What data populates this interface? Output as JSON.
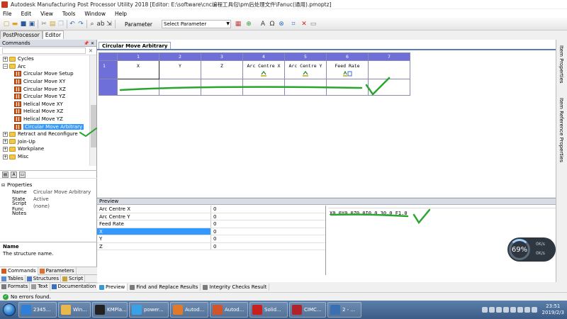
{
  "window": {
    "title": "Autodesk Manufacturing Post Processor Utility 2018 [Editor: E:\\software\\cnc编程工具包\\pm后处理文件\\Fanuc(通用).pmoptz]"
  },
  "menu": [
    "File",
    "Edit",
    "View",
    "Tools",
    "Window",
    "Help"
  ],
  "toolbar": {
    "parameter_label": "Parameter",
    "select_parameter": "Select Parameter"
  },
  "top_tabs": [
    "PostProcessor",
    "Editor"
  ],
  "commands_panel": {
    "header": "Commands",
    "pin": "📌",
    "close": "✕",
    "tree": [
      {
        "label": "Cycles",
        "kind": "folder",
        "expander": "+",
        "indent": 1
      },
      {
        "label": "Arc",
        "kind": "folder",
        "expander": "−",
        "indent": 1
      },
      {
        "label": "Circular Move Setup",
        "kind": "item",
        "indent": 2
      },
      {
        "label": "Circular Move XY",
        "kind": "item",
        "indent": 2
      },
      {
        "label": "Circular Move XZ",
        "kind": "item",
        "indent": 2
      },
      {
        "label": "Circular Move YZ",
        "kind": "item",
        "indent": 2
      },
      {
        "label": "Helical Move XY",
        "kind": "item",
        "indent": 2
      },
      {
        "label": "Helical Move XZ",
        "kind": "item",
        "indent": 2
      },
      {
        "label": "Helical Move YZ",
        "kind": "item",
        "indent": 2
      },
      {
        "label": "Circular Move Arbitrary",
        "kind": "item",
        "indent": 2,
        "selected": true
      },
      {
        "label": "Retract and Reconfigure",
        "kind": "folder",
        "expander": "+",
        "indent": 1
      },
      {
        "label": "Join-Up",
        "kind": "folder",
        "expander": "+",
        "indent": 1
      },
      {
        "label": "Workplane",
        "kind": "folder",
        "expander": "+",
        "indent": 1
      },
      {
        "label": "Misc",
        "kind": "folder",
        "expander": "+",
        "indent": 1
      }
    ]
  },
  "properties": {
    "group": "Properties",
    "rows": [
      {
        "key": "Name",
        "value": "Circular Move Arbitrary"
      },
      {
        "key": "State",
        "value": "Active"
      },
      {
        "key": "Script Func",
        "value": "(none)"
      },
      {
        "key": "Notes",
        "value": ""
      }
    ],
    "desc_title": "Name",
    "desc_text": "The structure name."
  },
  "left_bottom_tabs": {
    "row1": [
      "Commands",
      "Parameters"
    ],
    "row2": [
      "Tables",
      "Structures",
      "Script"
    ],
    "row3": [
      "Formats",
      "Text",
      "Documentation"
    ]
  },
  "editor": {
    "doc_tab": "Circular Move Arbitrary",
    "column_numbers": [
      "1",
      "2",
      "3",
      "4",
      "5",
      "6",
      "7"
    ],
    "row_number": "1",
    "cells": [
      "X",
      "Y",
      "Z",
      "Arc Centre X",
      "Arc Centre Y",
      "Feed Rate",
      ""
    ]
  },
  "right_vertical_tabs": [
    "Item Properties",
    "Item Reference Properties"
  ],
  "preview": {
    "header": "Preview",
    "rows": [
      {
        "name": "Arc Centre X",
        "value": "0"
      },
      {
        "name": "Arc Centre Y",
        "value": "0"
      },
      {
        "name": "Feed Rate",
        "value": "0"
      },
      {
        "name": "X",
        "value": "0",
        "selected": true
      },
      {
        "name": "Y",
        "value": "0"
      },
      {
        "name": "Z",
        "value": "0"
      }
    ],
    "output": "X0.0Y0.0Z0.0I0.0 30.0 F1.0",
    "tabs": [
      "Preview",
      "Find and Replace Results",
      "Integrity Checks Result"
    ]
  },
  "status": {
    "text": "No errors found."
  },
  "gauge": {
    "value": "69%",
    "up": "0K/s",
    "down": "0K/s"
  },
  "taskbar": {
    "buttons": [
      {
        "label": "2345...",
        "color": "#2f7fd8"
      },
      {
        "label": "Win...",
        "color": "#e8b94a"
      },
      {
        "label": "KMPla...",
        "color": "#222222"
      },
      {
        "label": "power...",
        "color": "#3aa1e6"
      },
      {
        "label": "Autod...",
        "color": "#e07a2a"
      },
      {
        "label": "Autod...",
        "color": "#d2552a"
      },
      {
        "label": "Solid...",
        "color": "#c8201e"
      },
      {
        "label": "CIMC...",
        "color": "#b0232a"
      },
      {
        "label": "2 - ...",
        "color": "#3a6fb0"
      }
    ],
    "time": "23:51",
    "date": "2019/2/3"
  },
  "colors": {
    "grid_header": "#6f6fd9",
    "selection": "#3399ff",
    "annotation": "#2aa52f"
  }
}
